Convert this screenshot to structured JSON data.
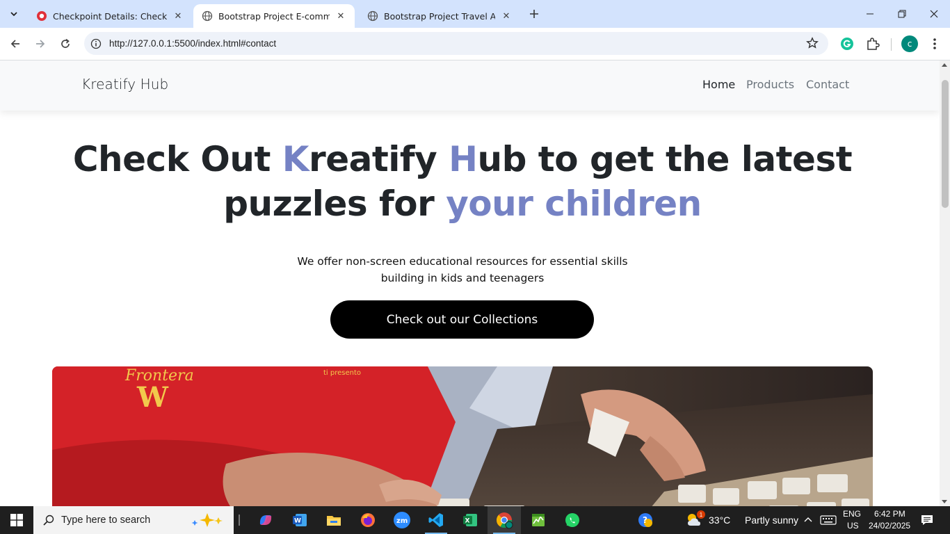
{
  "browser": {
    "tabs": [
      {
        "title": "Checkpoint Details: Checkpoint",
        "active": false
      },
      {
        "title": "Bootstrap Project E-commerce",
        "active": true
      },
      {
        "title": "Bootstrap Project Travel Agency",
        "active": false
      }
    ],
    "url": "http://127.0.0.1:5500/index.html#contact",
    "profile_initial": "c"
  },
  "site": {
    "brand": "Kreatify Hub",
    "nav": [
      "Home",
      "Products",
      "Contact"
    ],
    "hero": {
      "title_part1": "Check Out ",
      "title_k": "K",
      "title_part2": "reatify ",
      "title_h": "H",
      "title_part3": "ub to get the latest",
      "title_part4": "puzzles for ",
      "title_accent": "your children",
      "subtitle": "We offer non-screen educational resources for essential skills building in kids and teenagers",
      "cta": "Check out our Collections"
    },
    "colors": {
      "accent": "#7582c4",
      "cta_bg": "#000000"
    }
  },
  "taskbar": {
    "search_placeholder": "Type here to search",
    "weather_temp": "33°C",
    "weather_text": "Partly sunny",
    "weather_badge": "1",
    "lang": "ENG",
    "region": "US",
    "time": "6:42 PM",
    "date": "24/02/2025",
    "zoom_label": "zm"
  }
}
